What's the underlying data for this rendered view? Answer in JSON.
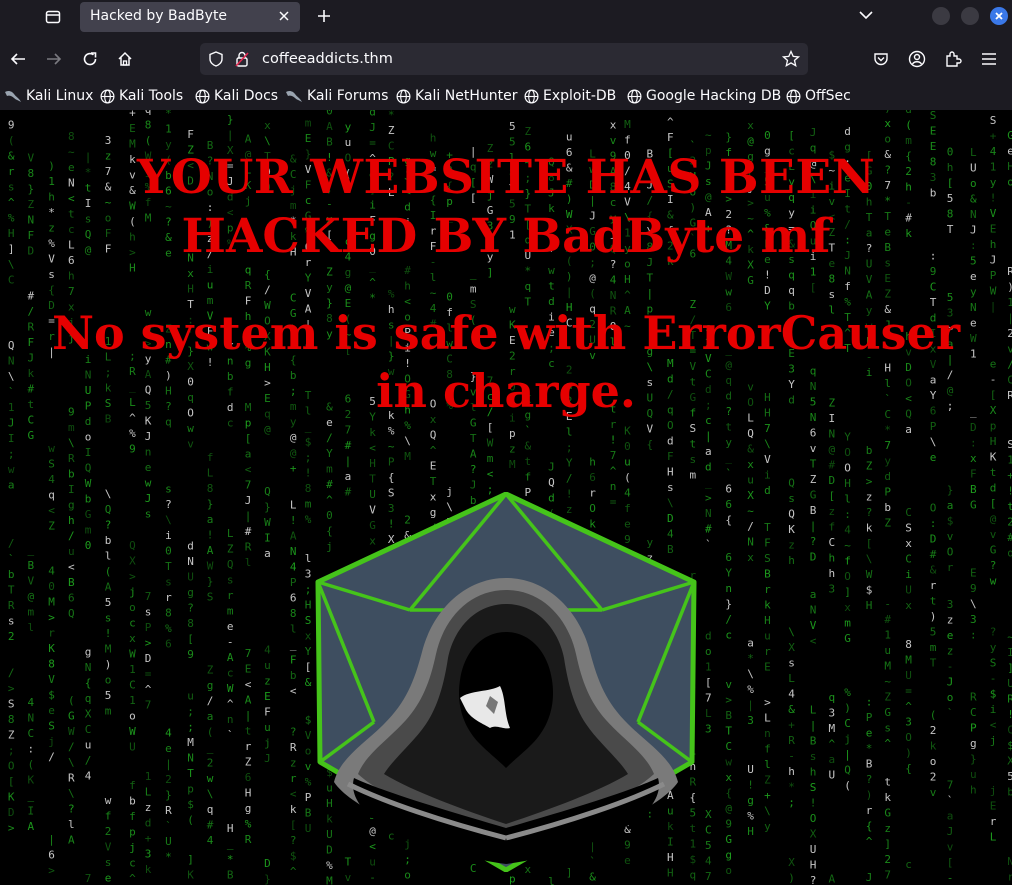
{
  "browser": {
    "tab": {
      "title": "Hacked by BadByte"
    },
    "address": {
      "url": "coffeeaddicts.thm"
    },
    "bookmarks": [
      {
        "label": "Kali Linux",
        "icon": "kali-dragon-icon"
      },
      {
        "label": "Kali Tools",
        "icon": "globe-icon"
      },
      {
        "label": "Kali Docs",
        "icon": "globe-icon"
      },
      {
        "label": "Kali Forums",
        "icon": "kali-dragon-icon"
      },
      {
        "label": "Kali NetHunter",
        "icon": "globe-icon"
      },
      {
        "label": "Exploit-DB",
        "icon": "globe-icon"
      },
      {
        "label": "Google Hacking DB",
        "icon": "globe-icon"
      },
      {
        "label": "OffSec",
        "icon": "globe-icon"
      }
    ]
  },
  "page": {
    "headline_line1": "YOUR WEBSITE HAS BEEN",
    "headline_line2": "HACKED BY BadByte mf",
    "subline_line1": "No system is safe with ErrorCauser",
    "subline_line2": "in charge.",
    "logo": "hooded-hacker-logo"
  },
  "colors": {
    "chrome_bg": "#1c1b22",
    "tab_bg": "#42414d",
    "urlbar_bg": "#2b2a33",
    "headline": "#e60000",
    "matrix_green": "#1fa51f",
    "logo_green": "#45c41a",
    "logo_slate": "#3e4e60",
    "close_button_blue": "#3a78e8"
  }
}
